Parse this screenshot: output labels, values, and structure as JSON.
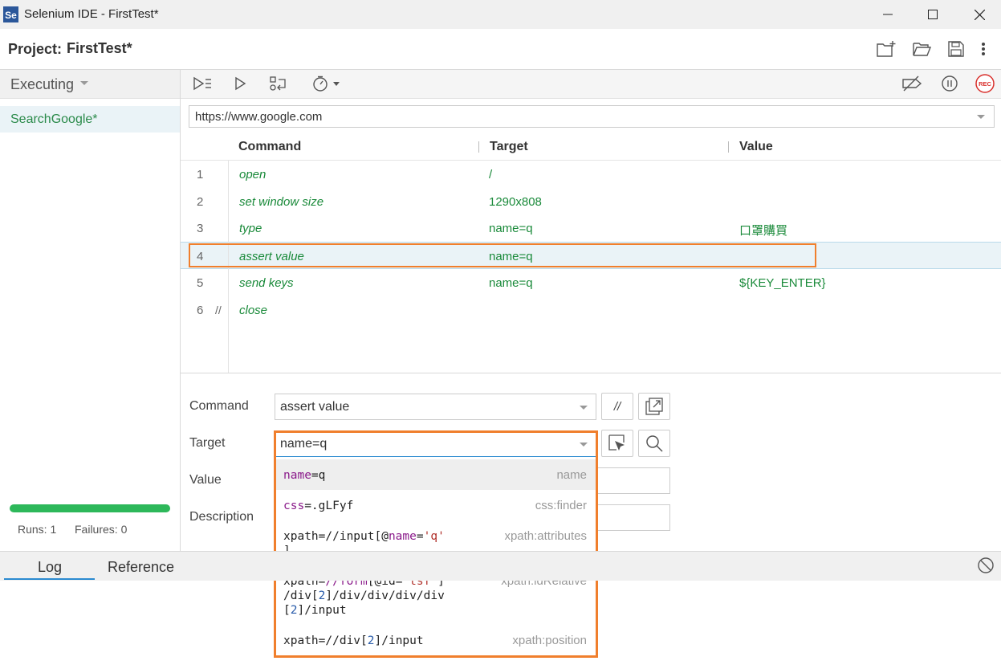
{
  "window": {
    "title": "Selenium IDE - FirstTest*",
    "app_icon_text": "Se"
  },
  "project": {
    "label": "Project:",
    "name": "FirstTest*"
  },
  "left": {
    "mode": "Executing",
    "tests": [
      "SearchGoogle*"
    ],
    "progress": 1.0,
    "runs_label": "Runs: 1",
    "failures_label": "Failures: 0"
  },
  "url": {
    "value": "https://www.google.com"
  },
  "table": {
    "headers": {
      "command": "Command",
      "target": "Target",
      "value": "Value"
    },
    "rows": [
      {
        "num": "1",
        "comment": "",
        "command": "open",
        "target": "/",
        "value": ""
      },
      {
        "num": "2",
        "comment": "",
        "command": "set window size",
        "target": "1290x808",
        "value": ""
      },
      {
        "num": "3",
        "comment": "",
        "command": "type",
        "target": "name=q",
        "value": "口罩購買"
      },
      {
        "num": "4",
        "comment": "",
        "command": "assert value",
        "target": "name=q",
        "value": ""
      },
      {
        "num": "5",
        "comment": "",
        "command": "send keys",
        "target": "name=q",
        "value": "${KEY_ENTER}"
      },
      {
        "num": "6",
        "comment": "//",
        "command": "close",
        "target": "",
        "value": ""
      }
    ],
    "selected_row": 4
  },
  "editor": {
    "command_label": "Command",
    "command_value": "assert value",
    "comment_btn": "//",
    "target_label": "Target",
    "target_value": "name=q",
    "value_label": "Value",
    "description_label": "Description"
  },
  "target_dropdown": {
    "items": [
      {
        "tag": "name"
      },
      {
        "tag": "css:finder"
      },
      {
        "tag": "xpath:attributes"
      },
      {
        "tag": "xpath:idRelative"
      },
      {
        "tag": "xpath:position"
      }
    ],
    "text": {
      "i1_a": "name",
      "i1_b": "=q",
      "i2_a": "css",
      "i2_b": "=.gLFyf",
      "i3_a": "xpath=//input[@",
      "i3_b": "name",
      "i3_c": "=",
      "i3_d": "'q'",
      "i3_e": "]",
      "i4_a": "xpath=",
      "i4_b": "//",
      "i4_c": "form",
      "i4_d": "[@id=",
      "i4_e": "'tsf'",
      "i4_f": "]",
      "i4_g": "/div[",
      "i4_h": "2",
      "i4_i": "]/div/div/div/div",
      "i4_j": "[",
      "i4_k": "2",
      "i4_l": "]/input",
      "i5_a": "xpath=//div[",
      "i5_b": "2",
      "i5_c": "]/input"
    }
  },
  "bottom": {
    "tabs": [
      "Log",
      "Reference"
    ],
    "active_tab": "Log"
  },
  "colors": {
    "accent_green": "#2db85a",
    "highlight_orange": "#f07f2d",
    "rec_red": "#d9302c"
  }
}
